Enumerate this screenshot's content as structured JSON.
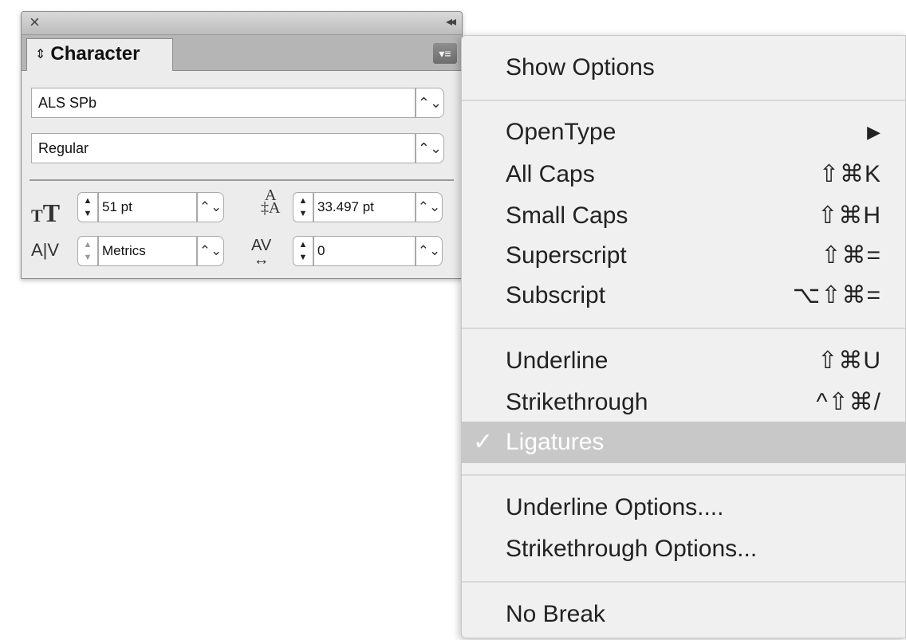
{
  "panel": {
    "tab_label": "Character",
    "font_family": "ALS SPb",
    "font_style": "Regular",
    "font_size": "51 pt",
    "leading": "33.497 pt",
    "kerning": "Metrics",
    "tracking": "0"
  },
  "menu": {
    "show_options": "Show Options",
    "opentype": "OpenType",
    "all_caps": "All Caps",
    "all_caps_sc": "⇧⌘K",
    "small_caps": "Small Caps",
    "small_caps_sc": "⇧⌘H",
    "superscript": "Superscript",
    "superscript_sc": "⇧⌘=",
    "subscript": "Subscript",
    "subscript_sc": "⌥⇧⌘=",
    "underline": "Underline",
    "underline_sc": "⇧⌘U",
    "strikethrough": "Strikethrough",
    "strikethrough_sc": "^⇧⌘/",
    "ligatures": "Ligatures",
    "underline_options": "Underline Options....",
    "strikethrough_options": "Strikethrough Options...",
    "no_break": "No Break"
  },
  "icons": {
    "close": "close-icon",
    "collapse": "collapse-icon",
    "panel_menu": "panel-menu-icon",
    "font_size": "font-size-icon",
    "leading": "leading-icon",
    "kerning": "kerning-icon",
    "tracking": "tracking-icon",
    "submenu": "submenu-arrow-icon",
    "check": "check-icon"
  }
}
